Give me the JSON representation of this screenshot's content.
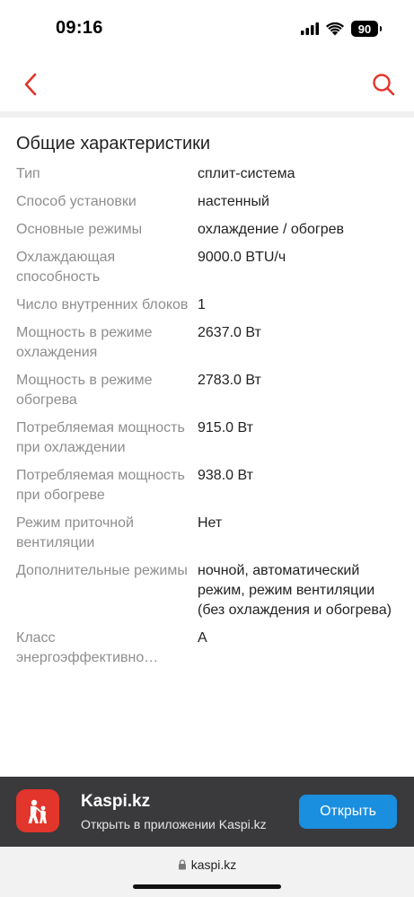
{
  "status_bar": {
    "time": "09:16",
    "battery": "90"
  },
  "nav": {
    "back_icon": "chevron-left-icon",
    "search_icon": "search-icon"
  },
  "section": {
    "title": "Общие характеристики"
  },
  "specs": [
    {
      "label": "Тип",
      "value": "сплит-система"
    },
    {
      "label": "Способ установки",
      "value": "настенный"
    },
    {
      "label": "Основные режимы",
      "value": "охлаждение / обогрев"
    },
    {
      "label": "Охлаждающая способность",
      "value": "9000.0 BTU/ч"
    },
    {
      "label": "Число внутренних блоков",
      "value": "1"
    },
    {
      "label": "Мощность в режиме охлаждения",
      "value": "2637.0 Вт"
    },
    {
      "label": "Мощность в режиме обогрева",
      "value": "2783.0 Вт"
    },
    {
      "label": "Потребляемая мощность при охлаждении",
      "value": "915.0 Вт"
    },
    {
      "label": "Потребляемая мощность при обогреве",
      "value": "938.0 Вт"
    },
    {
      "label": "Режим приточной вентиляции",
      "value": "Нет"
    },
    {
      "label": "Дополнительные режимы",
      "value": "ночной, автоматический режим, режим вентиляции (без охлаждения и обогрева)"
    },
    {
      "label": "Класс энергоэффективно…",
      "value": "A"
    }
  ],
  "app_banner": {
    "name": "Kaspi.kz",
    "subtitle": "Открыть в приложении Kaspi.kz",
    "open_label": "Открыть"
  },
  "browser": {
    "url": "kaspi.kz"
  },
  "colors": {
    "accent": "#e2352b",
    "button_blue": "#1a8fe0",
    "label_gray": "#8e8e8e",
    "banner_bg": "#3a3a3c"
  }
}
